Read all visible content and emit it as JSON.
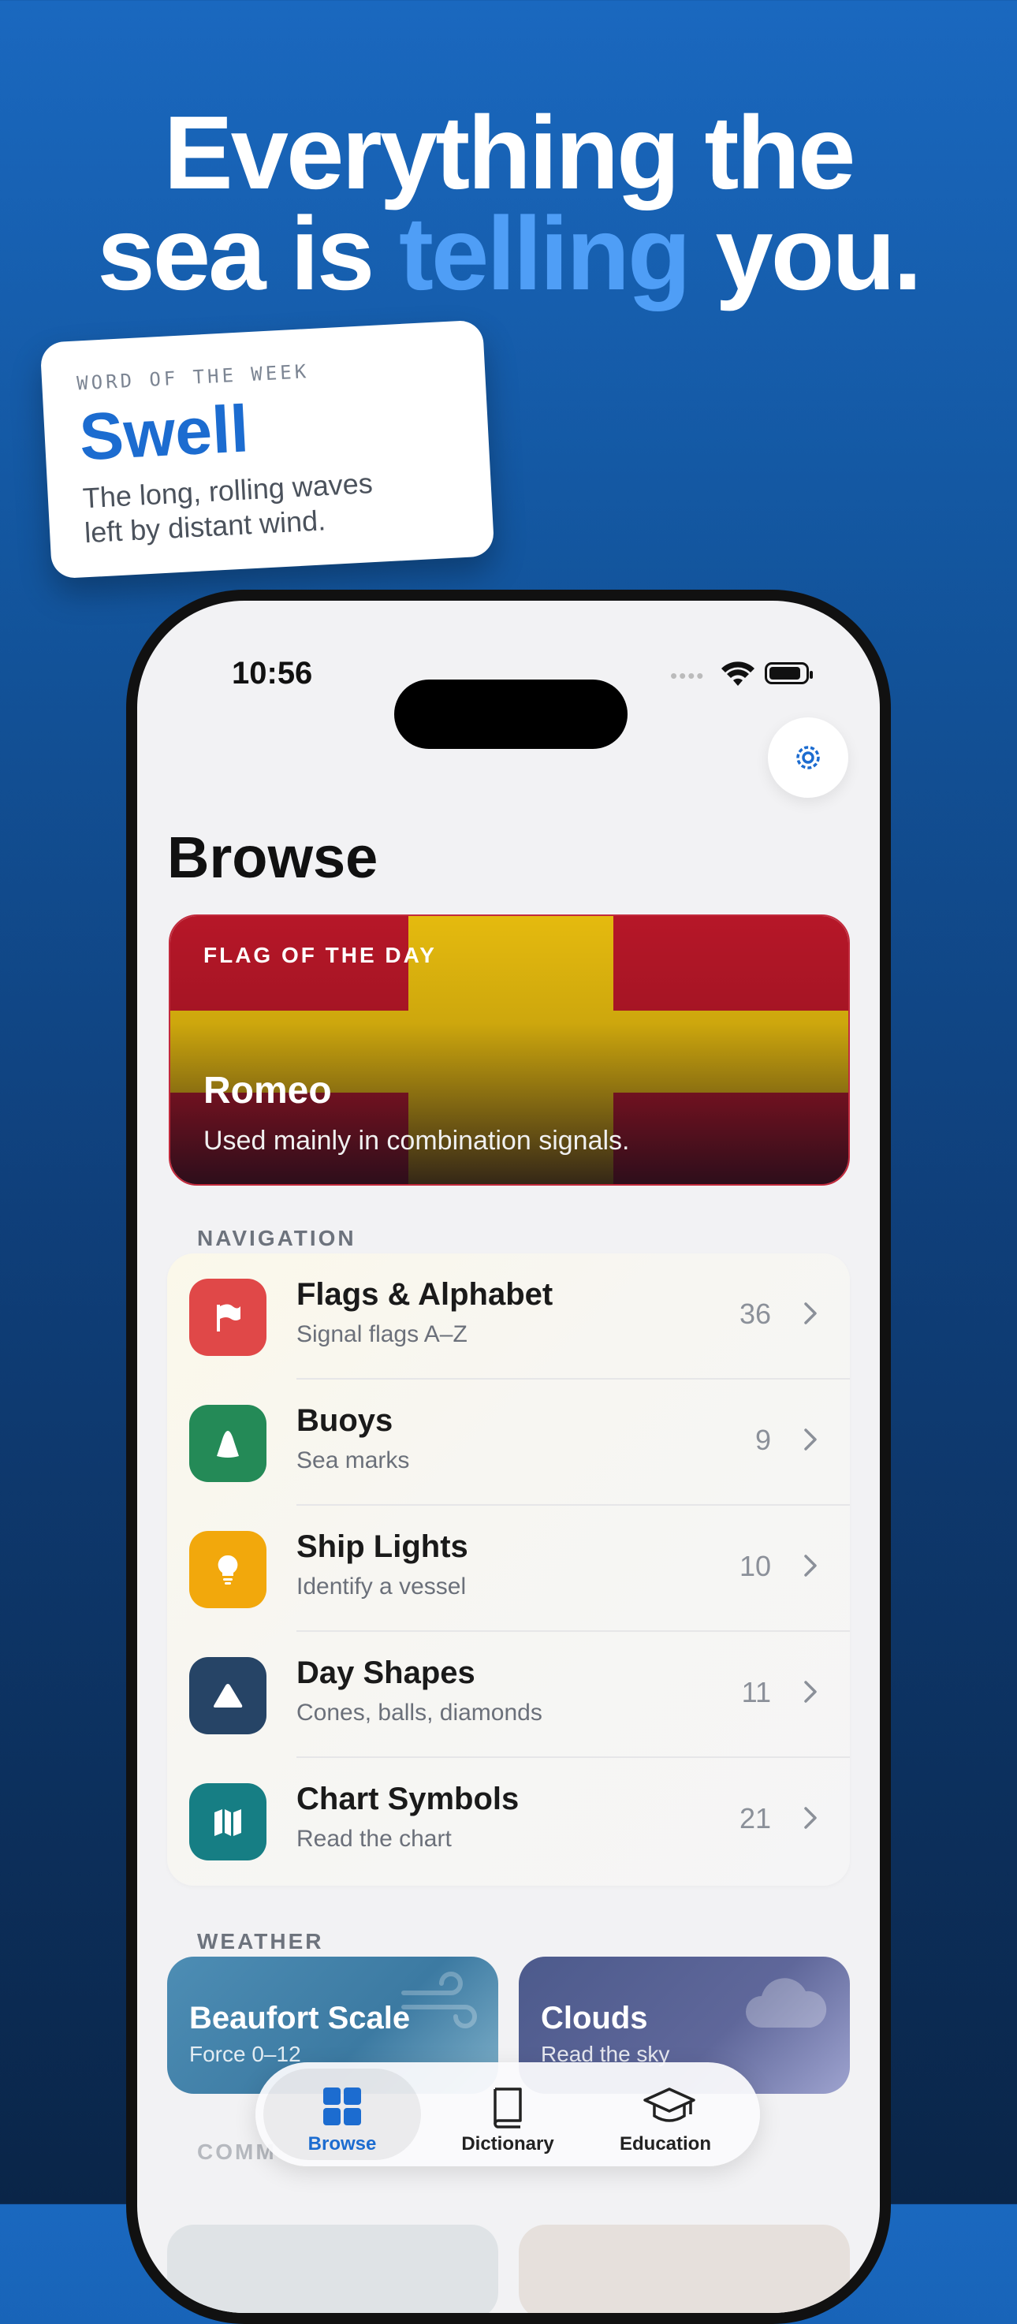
{
  "headline": {
    "line1": "Everything the",
    "line2_start": "sea is ",
    "line2_accent": "telling",
    "line2_end": " you."
  },
  "word_of_week": {
    "kicker": "WORD OF THE WEEK",
    "word": "Swell",
    "line1": "The long, rolling waves",
    "line2": "left by distant wind."
  },
  "status_bar": {
    "time": "10:56",
    "dots": "••••"
  },
  "page": {
    "title": "Browse",
    "settings_icon": "gear-icon"
  },
  "flag_of_day": {
    "kicker": "FLAG OF THE DAY",
    "name": "Romeo",
    "description": "Used mainly in combination signals.",
    "colors": {
      "red": "#c0182a",
      "yellow": "#f1c40f"
    }
  },
  "navigation": {
    "label": "NAVIGATION",
    "items": [
      {
        "title": "Flags & Alphabet",
        "subtitle": "Signal flags A–Z",
        "count": "36",
        "icon": "flag-icon",
        "color": "#e04848"
      },
      {
        "title": "Buoys",
        "subtitle": "Sea marks",
        "count": "9",
        "icon": "buoy-icon",
        "color": "#248a57"
      },
      {
        "title": "Ship Lights",
        "subtitle": "Identify a vessel",
        "count": "10",
        "icon": "lightbulb-icon",
        "color": "#f2a80c"
      },
      {
        "title": "Day Shapes",
        "subtitle": "Cones, balls, diamonds",
        "count": "11",
        "icon": "triangle-icon",
        "color": "#264466"
      },
      {
        "title": "Chart Symbols",
        "subtitle": "Read the chart",
        "count": "21",
        "icon": "map-icon",
        "color": "#167e84"
      }
    ]
  },
  "weather": {
    "label": "WEATHER",
    "tiles": [
      {
        "title": "Beaufort Scale",
        "subtitle": "Force 0–12",
        "icon": "wind-icon",
        "color": "#3e7ea6"
      },
      {
        "title": "Clouds",
        "subtitle": "Read the sky",
        "icon": "cloud-icon",
        "color": "#5a6394"
      }
    ]
  },
  "next_section_label": "COMM",
  "tabbar": {
    "tabs": [
      {
        "label": "Browse",
        "icon": "grid-icon",
        "active": true
      },
      {
        "label": "Dictionary",
        "icon": "book-icon",
        "active": false
      },
      {
        "label": "Education",
        "icon": "graduation-cap-icon",
        "active": false
      }
    ]
  }
}
